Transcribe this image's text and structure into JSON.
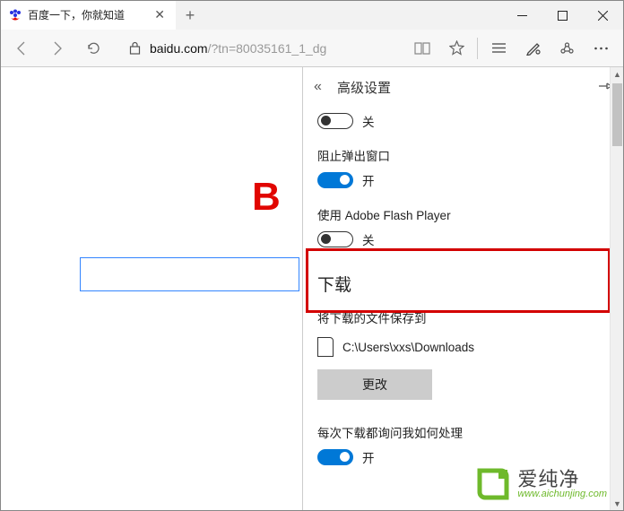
{
  "tab": {
    "title": "百度一下，你就知道"
  },
  "url": {
    "host": "baidu.com",
    "rest": "/?tn=80035161_1_dg"
  },
  "page": {
    "logo_fragment": "B"
  },
  "panel": {
    "title": "高级设置",
    "toggle0": {
      "state": "关"
    },
    "popup": {
      "label": "阻止弹出窗口",
      "state": "开"
    },
    "flash": {
      "label": "使用 Adobe Flash Player",
      "state": "关"
    },
    "downloads": {
      "heading": "下载",
      "save_label": "将下载的文件保存到",
      "path": "C:\\Users\\xxs\\Downloads",
      "change": "更改",
      "ask_label": "每次下载都询问我如何处理",
      "ask_state": "开"
    }
  },
  "watermark": {
    "cn": "爱纯净",
    "url": "www.aichunjing.com"
  }
}
